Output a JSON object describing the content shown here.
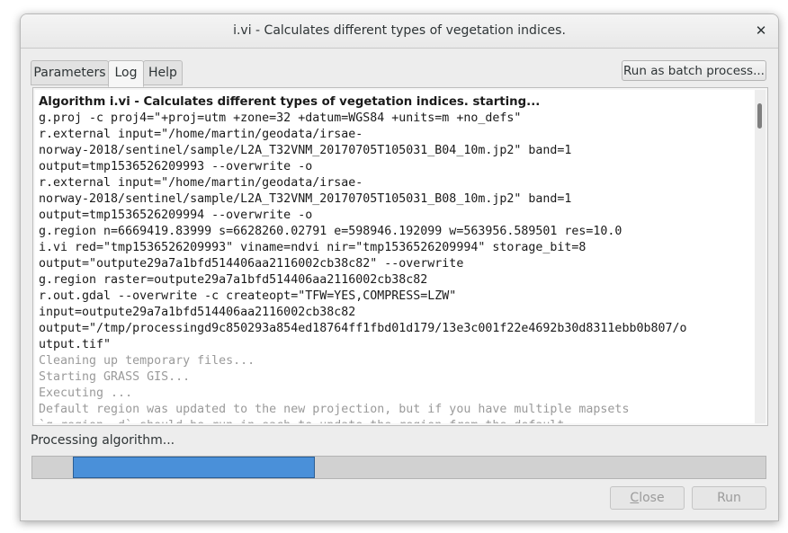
{
  "window": {
    "title": "i.vi - Calculates different types of vegetation indices.",
    "close_glyph": "✕"
  },
  "tabs": [
    {
      "label": "Parameters",
      "active": false
    },
    {
      "label": "Log",
      "active": true
    },
    {
      "label": "Help",
      "active": false
    }
  ],
  "toolbar": {
    "batch_label": "Run as batch process..."
  },
  "log": {
    "lines": [
      {
        "text": "Algorithm i.vi - Calculates different types of vegetation indices. starting...",
        "style": "header"
      },
      {
        "text": "g.proj -c proj4=\"+proj=utm +zone=32 +datum=WGS84 +units=m +no_defs\"",
        "style": "normal"
      },
      {
        "text": "r.external input=\"/home/martin/geodata/irsae-",
        "style": "normal"
      },
      {
        "text": "norway-2018/sentinel/sample/L2A_T32VNM_20170705T105031_B04_10m.jp2\" band=1",
        "style": "normal"
      },
      {
        "text": "output=tmp1536526209993 --overwrite -o",
        "style": "normal"
      },
      {
        "text": "r.external input=\"/home/martin/geodata/irsae-",
        "style": "normal"
      },
      {
        "text": "norway-2018/sentinel/sample/L2A_T32VNM_20170705T105031_B08_10m.jp2\" band=1",
        "style": "normal"
      },
      {
        "text": "output=tmp1536526209994 --overwrite -o",
        "style": "normal"
      },
      {
        "text": "g.region n=6669419.83999 s=6628260.02791 e=598946.192099 w=563956.589501 res=10.0",
        "style": "normal"
      },
      {
        "text": "i.vi red=\"tmp1536526209993\" viname=ndvi nir=\"tmp1536526209994\" storage_bit=8",
        "style": "normal"
      },
      {
        "text": "output=\"outpute29a7a1bfd514406aa2116002cb38c82\" --overwrite",
        "style": "normal"
      },
      {
        "text": "g.region raster=outpute29a7a1bfd514406aa2116002cb38c82",
        "style": "normal"
      },
      {
        "text": "r.out.gdal --overwrite -c createopt=\"TFW=YES,COMPRESS=LZW\"",
        "style": "normal"
      },
      {
        "text": "input=outpute29a7a1bfd514406aa2116002cb38c82",
        "style": "normal"
      },
      {
        "text": "output=\"/tmp/processingd9c850293a854ed18764ff1fbd01d179/13e3c001f22e4692b30d8311ebb0b807/o",
        "style": "normal"
      },
      {
        "text": "utput.tif\"",
        "style": "normal"
      },
      {
        "text": "Cleaning up temporary files...",
        "style": "gray"
      },
      {
        "text": "Starting GRASS GIS...",
        "style": "gray"
      },
      {
        "text": "Executing ...",
        "style": "gray"
      },
      {
        "text": "Default region was updated to the new projection, but if you have multiple mapsets",
        "style": "gray"
      },
      {
        "text": "`g.region -d` should be run in each to update the region from the default",
        "style": "gray"
      }
    ]
  },
  "status": {
    "text": "Processing algorithm...",
    "progress_start": 0.055,
    "progress_end": 0.385
  },
  "footer": {
    "close_label": "Close",
    "run_label": "Run"
  },
  "colors": {
    "progress_fill": "#4a90d9",
    "disabled_text": "#9b9b9b"
  }
}
